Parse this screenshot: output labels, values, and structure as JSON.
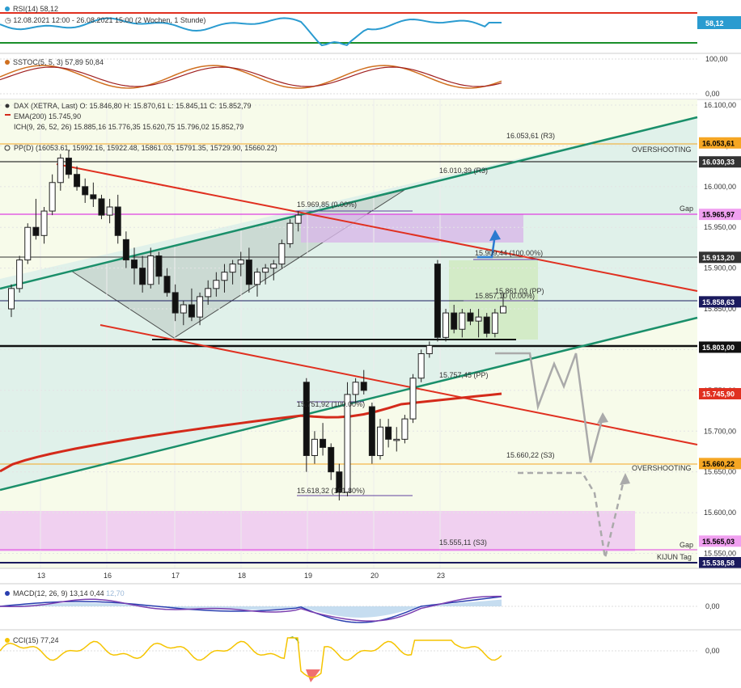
{
  "indicators": {
    "rsi": {
      "label": "RSI(14)",
      "value": "58,12",
      "period": "12.08.2021 12:00 - 26.08.2021 15:00",
      "interval": "(2 Wochen, 1 Stunde)",
      "axis_value": "58,12"
    },
    "sstoc": {
      "label": "SSTOC(5, 5, 3)",
      "v1": "57,89",
      "v2": "50,84",
      "axis_top": "100,00",
      "axis_bottom": "0,00"
    },
    "macd": {
      "label": "MACD(12, 26, 9)",
      "v1": "13,14",
      "v2": "0,44",
      "v3": "12,70",
      "axis_zero": "0,00"
    },
    "cci": {
      "label": "CCI(15)",
      "value": "77,24",
      "axis_zero": "0,00"
    }
  },
  "main": {
    "instrument": "DAX (XETRA, Last)",
    "ohlc": "O: 15.846,80  H: 15.870,61  L: 15.845,11  C: 15.852,79",
    "ema_label": "EMA(200)",
    "ema_value": "15.745,90",
    "ichimoku_label": "ICH(9, 26, 52, 26)",
    "ichimoku_values": "15.885,16  15.776,35  15.620,75  15.796,02  15.852,79",
    "pp_label": "PP(D)",
    "pp_values": "(16053.61, 15992.16, 15922.48, 15861.03, 15791.35, 15729.90, 15660.22)"
  },
  "annotations": {
    "r3_top": "16.053,61 (R3)",
    "r3_mid": "16.010,39 (R3)",
    "fib1": "15.969,85 (0.00%)",
    "fib2": "15.909,44 (100.00%)",
    "pp_mid": "15.861,03 (PP)",
    "fib3": "15.857,10 (0.00%)",
    "fib4": "15.751,92 (100.00%)",
    "pp_low": "15.757,45 (PP)",
    "s3_mid": "15.660,22 (S3)",
    "fib5": "15.618,32 (161.80%)",
    "s3_low": "15.555,11 (S3)",
    "overshooting_top": "OVERSHOOTING",
    "overshooting_bottom": "OVERSHOOTING",
    "gap_top": "Gap",
    "gap_bottom": "Gap",
    "kijun": "KIJUN Tag"
  },
  "price_tags": [
    {
      "value": "16.053,61",
      "bg": "#f5a623",
      "color": "#000000"
    },
    {
      "value": "16.030,33",
      "bg": "#333333",
      "color": "#ffffff"
    },
    {
      "value": "15.965,97",
      "bg": "#f0a0f0",
      "color": "#000000"
    },
    {
      "value": "15.913,20",
      "bg": "#333333",
      "color": "#ffffff"
    },
    {
      "value": "15.858,63",
      "bg": "#1a1a5e",
      "color": "#ffffff"
    },
    {
      "value": "15.803,00",
      "bg": "#111111",
      "color": "#ffffff"
    },
    {
      "value": "15.745,90",
      "bg": "#e03020",
      "color": "#ffffff"
    },
    {
      "value": "15.660,22",
      "bg": "#f5a623",
      "color": "#000000"
    },
    {
      "value": "15.565,03",
      "bg": "#f0a0f0",
      "color": "#000000"
    },
    {
      "value": "15.538,58",
      "bg": "#1a1a5e",
      "color": "#ffffff"
    }
  ],
  "axis": [
    "16.100,00",
    "16.050,00",
    "16.000,00",
    "15.950,00",
    "15.900,00",
    "15.850,00",
    "15.800,00",
    "15.750,00",
    "15.700,00",
    "15.650,00",
    "15.600,00",
    "15.550,00"
  ],
  "colors": {
    "rsi_line": "#2a9bd0",
    "rsi_upper": "#e03020",
    "rsi_lower": "#1a8f2a",
    "ema": "#d42a1a",
    "trend_green": "#1a8f6a",
    "trend_red": "#e03020",
    "cci_line": "#f5c400",
    "macd_line": "#2a3fb0",
    "signal_line": "#7a3fb0"
  },
  "chart_data": {
    "type": "candlestick",
    "instrument": "DAX (XETRA, Last)",
    "x_ticks": [
      "13",
      "16",
      "17",
      "18",
      "19",
      "20",
      "23"
    ],
    "y_range": [
      15520,
      16110
    ],
    "levels": [
      16053.61,
      16030.33,
      16010.39,
      15965.97,
      15913.2,
      15861.03,
      15858.63,
      15803.0,
      15757.45,
      15745.9,
      15660.22,
      15565.03,
      15555.11,
      15538.58
    ],
    "candles": [
      [
        15850,
        15880,
        15840,
        15875
      ],
      [
        15875,
        15915,
        15870,
        15910
      ],
      [
        15910,
        15955,
        15905,
        15950
      ],
      [
        15950,
        15985,
        15935,
        15940
      ],
      [
        15940,
        15975,
        15930,
        15970
      ],
      [
        15970,
        16015,
        15965,
        16005
      ],
      [
        16005,
        16040,
        15995,
        16035
      ],
      [
        16035,
        16045,
        16010,
        16015
      ],
      [
        16015,
        16025,
        15995,
        16000
      ],
      [
        16000,
        16010,
        15980,
        15990
      ],
      [
        15990,
        16005,
        15975,
        15985
      ],
      [
        15985,
        15990,
        15960,
        15965
      ],
      [
        15965,
        15985,
        15955,
        15975
      ],
      [
        15975,
        15990,
        15930,
        15940
      ],
      [
        15935,
        15945,
        15900,
        15910
      ],
      [
        15910,
        15925,
        15880,
        15900
      ],
      [
        15900,
        15915,
        15870,
        15880
      ],
      [
        15880,
        15925,
        15875,
        15915
      ],
      [
        15915,
        15920,
        15880,
        15890
      ],
      [
        15890,
        15900,
        15865,
        15870
      ],
      [
        15870,
        15880,
        15835,
        15845
      ],
      [
        15845,
        15860,
        15830,
        15855
      ],
      [
        15855,
        15875,
        15835,
        15840
      ],
      [
        15840,
        15870,
        15830,
        15865
      ],
      [
        15865,
        15885,
        15855,
        15875
      ],
      [
        15875,
        15895,
        15865,
        15885
      ],
      [
        15885,
        15905,
        15870,
        15895
      ],
      [
        15895,
        15910,
        15880,
        15905
      ],
      [
        15905,
        15920,
        15890,
        15910
      ],
      [
        15910,
        15925,
        15870,
        15880
      ],
      [
        15880,
        15900,
        15865,
        15895
      ],
      [
        15895,
        15905,
        15880,
        15900
      ],
      [
        15900,
        15910,
        15885,
        15905
      ],
      [
        15905,
        15935,
        15900,
        15930
      ],
      [
        15930,
        15960,
        15925,
        15955
      ],
      [
        15955,
        15970,
        15945,
        15965
      ],
      [
        15760,
        15765,
        15650,
        15670
      ],
      [
        15670,
        15700,
        15660,
        15690
      ],
      [
        15690,
        15710,
        15670,
        15680
      ],
      [
        15680,
        15685,
        15640,
        15650
      ],
      [
        15650,
        15660,
        15615,
        15625
      ],
      [
        15625,
        15760,
        15620,
        15745
      ],
      [
        15745,
        15765,
        15735,
        15760
      ],
      [
        15760,
        15775,
        15745,
        15750
      ],
      [
        15730,
        15735,
        15660,
        15670
      ],
      [
        15670,
        15715,
        15665,
        15705
      ],
      [
        15705,
        15715,
        15680,
        15690
      ],
      [
        15690,
        15705,
        15675,
        15690
      ],
      [
        15690,
        15720,
        15685,
        15715
      ],
      [
        15715,
        15770,
        15710,
        15765
      ],
      [
        15765,
        15800,
        15760,
        15795
      ],
      [
        15795,
        15810,
        15790,
        15805
      ],
      [
        15905,
        15910,
        15810,
        15815
      ],
      [
        15815,
        15850,
        15810,
        15845
      ],
      [
        15845,
        15855,
        15820,
        15825
      ],
      [
        15825,
        15850,
        15815,
        15845
      ],
      [
        15845,
        15850,
        15830,
        15835
      ],
      [
        15835,
        15850,
        15815,
        15840
      ],
      [
        15840,
        15845,
        15815,
        15820
      ],
      [
        15820,
        15850,
        15815,
        15845
      ],
      [
        15845,
        15870,
        15845,
        15853
      ]
    ],
    "rsi": {
      "value": 58.12
    },
    "sstoc": {
      "k": 57.89,
      "d": 50.84
    },
    "macd": {
      "macd": 13.14,
      "signal": 0.44,
      "hist": 12.7
    },
    "cci": {
      "value": 77.24
    }
  }
}
